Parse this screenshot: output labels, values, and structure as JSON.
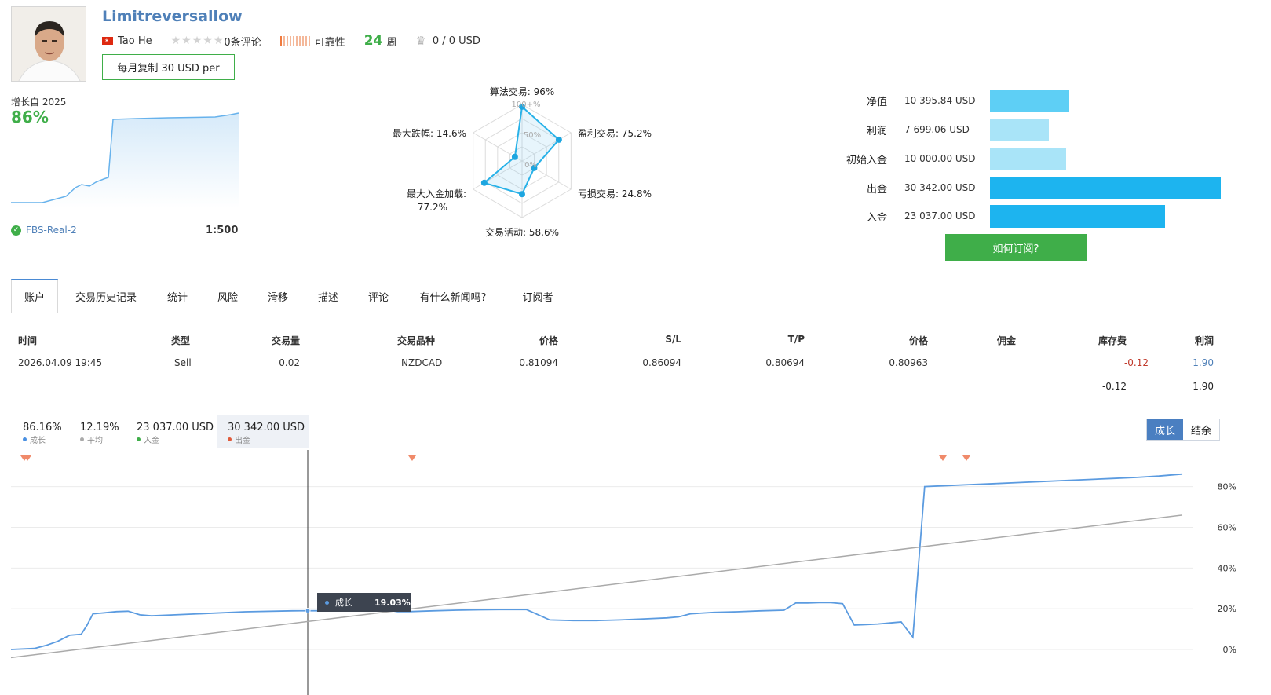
{
  "header": {
    "title": "Limitreversallow",
    "author": "Tao He",
    "reviews": "0条评论",
    "reliability": "可靠性",
    "weeks": "24",
    "weeks_unit": "周",
    "subscribers": "0 / 0 USD",
    "copy_button": "每月复制 30 USD per",
    "colors": {
      "title": "#4f80b8",
      "accent_green": "#3fae49"
    }
  },
  "growth": {
    "label": "增长自 2025",
    "value": "86%",
    "server": "FBS-Real-2",
    "leverage": "1:500"
  },
  "radar": {
    "labels": {
      "algo": "算法交易: 96%",
      "profit": "盈利交易: 75.2%",
      "loss": "亏损交易: 24.8%",
      "activity": "交易活动: 58.6%",
      "maxload_line1": "最大入金加载:",
      "maxload_line2": "77.2%",
      "drawdown": "最大跌幅: 14.6%"
    },
    "scale": {
      "p100": "100+%",
      "p50": "50%",
      "p0": "0%"
    },
    "values": [
      96,
      75.2,
      24.8,
      58.6,
      77.2,
      14.6
    ]
  },
  "stats": {
    "rows": [
      {
        "label": "净值",
        "value": "10 395.84 USD",
        "amount": 10395.84,
        "color": "#5ecff5"
      },
      {
        "label": "利润",
        "value": "7 699.06 USD",
        "amount": 7699.06,
        "color": "#a9e4f8"
      },
      {
        "label": "初始入金",
        "value": "10 000.00 USD",
        "amount": 10000.0,
        "color": "#a9e4f8"
      },
      {
        "label": "出金",
        "value": "30 342.00 USD",
        "amount": 30342.0,
        "color": "#1db4ef"
      },
      {
        "label": "入金",
        "value": "23 037.00 USD",
        "amount": 23037.0,
        "color": "#1db4ef"
      }
    ],
    "subscribe_button": "如何订阅?"
  },
  "tabs": [
    "账户",
    "交易历史记录",
    "统计",
    "风险",
    "滑移",
    "描述",
    "评论",
    "有什么新闻吗?",
    "订阅者"
  ],
  "table": {
    "headers": [
      "时间",
      "类型",
      "交易量",
      "交易品种",
      "价格",
      "S/L",
      "T/P",
      "价格",
      "佣金",
      "库存费",
      "利润"
    ],
    "row": [
      "2026.04.09 19:45",
      "Sell",
      "0.02",
      "NZDCAD",
      "0.81094",
      "0.86094",
      "0.80694",
      "0.80963",
      "",
      "-0.12",
      "1.90"
    ],
    "totals": {
      "swap": "-0.12",
      "profit": "1.90"
    }
  },
  "chart_legend": [
    {
      "value": "86.16%",
      "name": "成长",
      "color": "#4a90e2"
    },
    {
      "value": "12.19%",
      "name": "平均",
      "color": "#aaaaaa"
    },
    {
      "value": "23 037.00 USD",
      "name": "入金",
      "color": "#3fae49"
    },
    {
      "value": "30 342.00 USD",
      "name": "出金",
      "color": "#e05a3a"
    }
  ],
  "chart_toggle": {
    "growth": "成长",
    "balance": "结余"
  },
  "tooltip": {
    "name": "成长",
    "value": "19.03%"
  },
  "chart_data": {
    "type": "line",
    "y_ticks": [
      "80%",
      "60%",
      "40%",
      "20%",
      "0%"
    ],
    "ylim": [
      0,
      90
    ],
    "series": [
      {
        "name": "成长",
        "color": "#5b9be0",
        "x": [
          0,
          2,
          3,
          4,
          5,
          6,
          6.5,
          7,
          8,
          9,
          10,
          11,
          12,
          14,
          16,
          18,
          20,
          24,
          28,
          30,
          32,
          33,
          34,
          36,
          38,
          40,
          42,
          44,
          46,
          48,
          50,
          52,
          54,
          56,
          57,
          58,
          60,
          62,
          64,
          66,
          67,
          68,
          69,
          70,
          71,
          72,
          73,
          74,
          75,
          76,
          77,
          78,
          80,
          82,
          84,
          86,
          88,
          90,
          92,
          94,
          96,
          98,
          100
        ],
        "values": [
          0,
          0.5,
          2,
          4,
          7,
          7.5,
          12,
          17.5,
          18,
          18.6,
          18.8,
          17,
          16.5,
          17,
          17.5,
          18,
          18.5,
          19,
          19.03,
          19.2,
          19.5,
          18.6,
          18.6,
          19,
          19.3,
          19.5,
          19.6,
          19.6,
          14.5,
          14.2,
          14.2,
          14.5,
          15,
          15.5,
          16,
          17.5,
          18.2,
          18.5,
          19,
          19.3,
          22.8,
          22.8,
          23,
          23,
          22.5,
          12,
          12.2,
          12.5,
          13,
          13.5,
          6,
          80,
          80.5,
          81,
          81.5,
          82,
          82.5,
          83,
          83.5,
          84,
          84.5,
          85.2,
          86.16
        ]
      },
      {
        "name": "平均",
        "color": "#aaaaaa",
        "x": [
          0,
          100
        ],
        "values": [
          -4,
          66
        ]
      }
    ]
  }
}
